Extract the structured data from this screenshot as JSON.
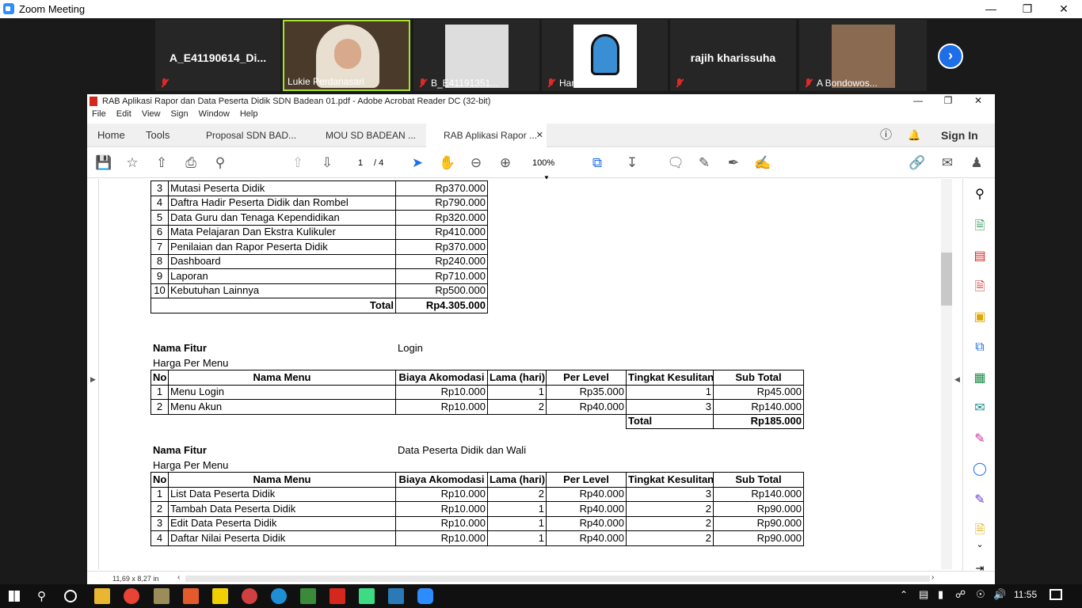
{
  "zoom": {
    "title": "Zoom Meeting",
    "participants": [
      {
        "label": "A_E41190614_Di..."
      },
      {
        "label": "Lukie Perdanasari"
      },
      {
        "label": "B_E41191351..."
      },
      {
        "label": "Hanif Satrio ..."
      },
      {
        "label": "rajih kharissuha"
      },
      {
        "label": "A Bondowos..."
      }
    ],
    "next_icon": "chevron-right-icon"
  },
  "acrobat": {
    "title": "RAB Aplikasi Rapor dan Data Peserta Didik SDN Badean 01.pdf - Adobe Acrobat Reader DC (32-bit)",
    "menu": [
      "File",
      "Edit",
      "View",
      "Sign",
      "Window",
      "Help"
    ],
    "tabs": {
      "home": "Home",
      "tools": "Tools",
      "docs": [
        "Proposal SDN BAD...",
        "MOU SD BADEAN ...",
        "RAB Aplikasi Rapor ..."
      ],
      "sign_in": "Sign In"
    },
    "page_current": "1",
    "page_total": "/ 4",
    "zoom_level": "100%",
    "status_size": "11,69 x 8,27 in"
  },
  "doc": {
    "summary_rows": [
      {
        "no": "3",
        "name": "Mutasi Peserta Didik",
        "price": "Rp370.000"
      },
      {
        "no": "4",
        "name": "Daftra Hadir Peserta Didik dan Rombel",
        "price": "Rp790.000"
      },
      {
        "no": "5",
        "name": "Data Guru dan Tenaga Kependidikan",
        "price": "Rp320.000"
      },
      {
        "no": "6",
        "name": "Mata Pelajaran Dan Ekstra Kulikuler",
        "price": "Rp410.000"
      },
      {
        "no": "7",
        "name": "Penilaian dan Rapor Peserta Didik",
        "price": "Rp370.000"
      },
      {
        "no": "8",
        "name": "Dashboard",
        "price": "Rp240.000"
      },
      {
        "no": "9",
        "name": "Laporan",
        "price": "Rp710.000"
      },
      {
        "no": "10",
        "name": "Kebutuhan Lainnya",
        "price": "Rp500.000"
      }
    ],
    "summary_total_label": "Total",
    "summary_total": "Rp4.305.000",
    "nama_fitur_label": "Nama Fitur",
    "harga_label": "Harga Per Menu",
    "headers": [
      "No",
      "Nama Menu",
      "Biaya Akomodasi",
      "Lama (hari)",
      "Per Level",
      "Tingkat Kesulitan",
      "Sub Total"
    ],
    "feature1": {
      "name": "Login",
      "rows": [
        [
          "1",
          "Menu Login",
          "Rp10.000",
          "1",
          "Rp35.000",
          "1",
          "Rp45.000"
        ],
        [
          "2",
          "Menu Akun",
          "Rp10.000",
          "2",
          "Rp40.000",
          "3",
          "Rp140.000"
        ]
      ],
      "total_label": "Total",
      "total": "Rp185.000"
    },
    "feature2": {
      "name": "Data Peserta Didik dan Wali",
      "rows": [
        [
          "1",
          "List Data Peserta Didik",
          "Rp10.000",
          "2",
          "Rp40.000",
          "3",
          "Rp140.000"
        ],
        [
          "2",
          "Tambah Data Peserta Didik",
          "Rp10.000",
          "1",
          "Rp40.000",
          "2",
          "Rp90.000"
        ],
        [
          "3",
          "Edit Data Peserta Didik",
          "Rp10.000",
          "1",
          "Rp40.000",
          "2",
          "Rp90.000"
        ],
        [
          "4",
          "Daftar Nilai Peserta Didik",
          "Rp10.000",
          "1",
          "Rp40.000",
          "2",
          "Rp90.000"
        ]
      ]
    }
  },
  "taskbar": {
    "time": "11:55"
  }
}
